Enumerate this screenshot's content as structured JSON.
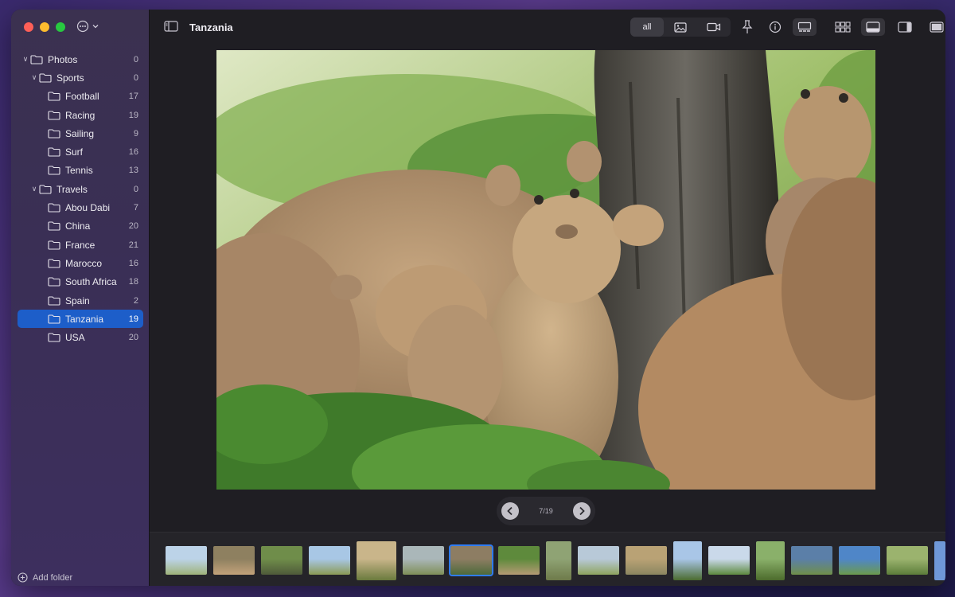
{
  "window": {
    "title": "Tanzania"
  },
  "sidebar": {
    "tree": [
      {
        "label": "Photos",
        "count": "0",
        "level": 0,
        "expanded": true
      },
      {
        "label": "Sports",
        "count": "0",
        "level": 1,
        "expanded": true
      },
      {
        "label": "Football",
        "count": "17",
        "level": 2
      },
      {
        "label": "Racing",
        "count": "19",
        "level": 2
      },
      {
        "label": "Sailing",
        "count": "9",
        "level": 2
      },
      {
        "label": "Surf",
        "count": "16",
        "level": 2
      },
      {
        "label": "Tennis",
        "count": "13",
        "level": 2
      },
      {
        "label": "Travels",
        "count": "0",
        "level": 1,
        "expanded": true
      },
      {
        "label": "Abou Dabi",
        "count": "7",
        "level": 2
      },
      {
        "label": "China",
        "count": "20",
        "level": 2
      },
      {
        "label": "France",
        "count": "21",
        "level": 2
      },
      {
        "label": "Marocco",
        "count": "16",
        "level": 2
      },
      {
        "label": "South Africa",
        "count": "18",
        "level": 2
      },
      {
        "label": "Spain",
        "count": "2",
        "level": 2
      },
      {
        "label": "Tanzania",
        "count": "19",
        "level": 2,
        "selected": true
      },
      {
        "label": "USA",
        "count": "20",
        "level": 2
      }
    ],
    "add_folder_label": "Add folder"
  },
  "toolbar": {
    "filter_all_label": "all",
    "icons": [
      "photo-filter-icon",
      "video-filter-icon",
      "pin-icon",
      "info-icon",
      "filmstrip-view-icon",
      "grid-view-icon",
      "bottom-panel-icon",
      "right-panel-icon",
      "fullscreen-icon"
    ]
  },
  "viewer": {
    "position_label": "7/19"
  },
  "colors": {
    "accent": "#1d5ec9",
    "selection_outline": "#2f7cf6"
  }
}
